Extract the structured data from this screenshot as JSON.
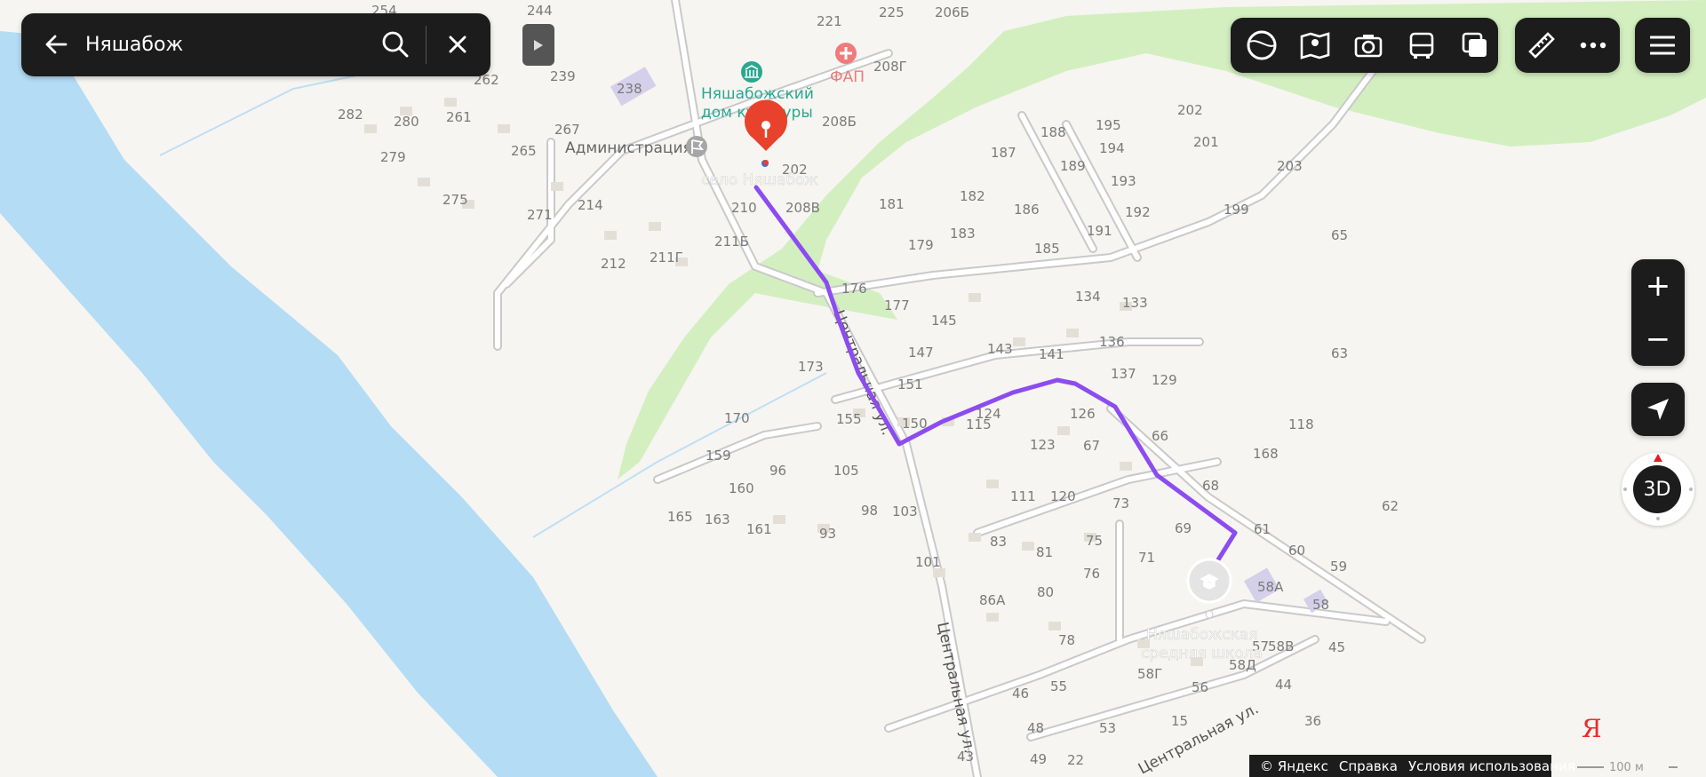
{
  "search": {
    "query": "Няшабож"
  },
  "labels": {
    "village": "село Няшабож",
    "culture_house_l1": "Няшабожский",
    "culture_house_l2": "дом культуры",
    "administration": "Администрация",
    "fap": "ФАП",
    "school_l1": "Няшабожская",
    "school_l2": "средняя школа",
    "street": "Центральная ул.",
    "street_bottom": "Центральная ул.",
    "street_corner": "Центральная ул."
  },
  "house_numbers": [
    "254",
    "244",
    "221",
    "225",
    "206Б",
    "262",
    "239",
    "238",
    "208Г",
    "282",
    "280",
    "261",
    "267",
    "208Б",
    "279",
    "265",
    "202",
    "275",
    "271",
    "214",
    "210",
    "208В",
    "188",
    "195",
    "202",
    "187",
    "189",
    "194",
    "201",
    "203",
    "193",
    "181",
    "182",
    "186",
    "192",
    "199",
    "191",
    "179",
    "183",
    "185",
    "212",
    "211Г",
    "211Б",
    "65",
    "176",
    "134",
    "133",
    "177",
    "145",
    "147",
    "143",
    "141",
    "136",
    "173",
    "151",
    "137",
    "129",
    "63",
    "170",
    "155",
    "150",
    "115",
    "124",
    "126",
    "66",
    "118",
    "123",
    "67",
    "168",
    "159",
    "96",
    "105",
    "160",
    "68",
    "111",
    "120",
    "73",
    "62",
    "165",
    "163",
    "161",
    "98",
    "103",
    "93",
    "69",
    "61",
    "83",
    "75",
    "60",
    "81",
    "71",
    "101",
    "59",
    "76",
    "58А",
    "86А",
    "80",
    "58",
    "78",
    "57",
    "58Г",
    "58В",
    "58Д",
    "45",
    "46",
    "55",
    "56",
    "44",
    "48",
    "53",
    "15",
    "36",
    "43",
    "49",
    "22"
  ],
  "controls": {
    "zoom_in": "+",
    "zoom_out": "−",
    "three_d": "3D"
  },
  "footer": {
    "copyright": "© Яндекс",
    "help": "Справка",
    "terms": "Условия использования",
    "scale": "100 м",
    "logo": "Я"
  },
  "colors": {
    "route": "#8c4cf0",
    "river": "#b4dcf5",
    "forest": "#d3efc0",
    "pin": "#e8422c",
    "panel": "#1c1c1c"
  }
}
